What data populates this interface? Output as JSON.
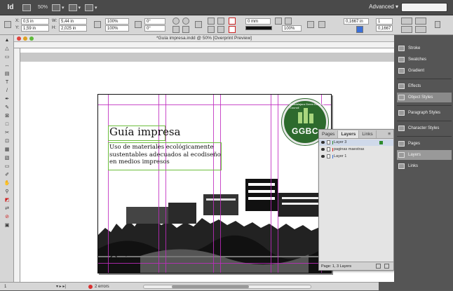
{
  "appbar": {
    "logo": "Id",
    "zoom": "50%",
    "workspace": "Advanced",
    "search_placeholder": ""
  },
  "controlbar": {
    "x_label": "X:",
    "x_value": "0,5 in",
    "y_label": "Y:",
    "y_value": "1,59 in",
    "w_label": "W:",
    "w_value": "5,44 in",
    "h_label": "H:",
    "h_value": "2,025 in",
    "scale_x": "100%",
    "scale_y": "100%",
    "rotate": "0°",
    "shear": "0°",
    "stroke_weight": "0 mm",
    "opacity": "100%",
    "gutter_value": "0,1667 in",
    "columns_value": "1",
    "gutter2_value": "0,1667"
  },
  "document": {
    "window_title": "*Guía impresa.indd @ 50% [Overprint Preview]",
    "title": "Guía impresa",
    "body": "Uso de materiales ecológicamente sustentables adecuados al ecodiseño en medios impresos",
    "caption": "Guía",
    "logo_ring": "Guadalajara Green Building Council",
    "logo_text": "GGBC"
  },
  "layers_panel": {
    "tabs": [
      "Pages",
      "Layers",
      "Links"
    ],
    "active_tab": "Layers",
    "rows": [
      {
        "name": "Layer 3",
        "color": "#2e8b2e"
      },
      {
        "name": "paginas maestras",
        "color": "#d22"
      },
      {
        "name": "Layer 1",
        "color": "#3a6fd8"
      }
    ],
    "footer": "Page: 1, 3 Layers"
  },
  "dock": {
    "items": [
      "Stroke",
      "Swatches",
      "Gradient",
      "Effects",
      "Object Styles",
      "Paragraph Styles",
      "Character Styles",
      "Pages",
      "Layers",
      "Links"
    ]
  },
  "status": {
    "page": "1",
    "errors": "2 errors"
  },
  "colors": {
    "guide": "#c02cc0",
    "frame": "#6cbe3c",
    "logo_green": "#2d6a2d"
  }
}
